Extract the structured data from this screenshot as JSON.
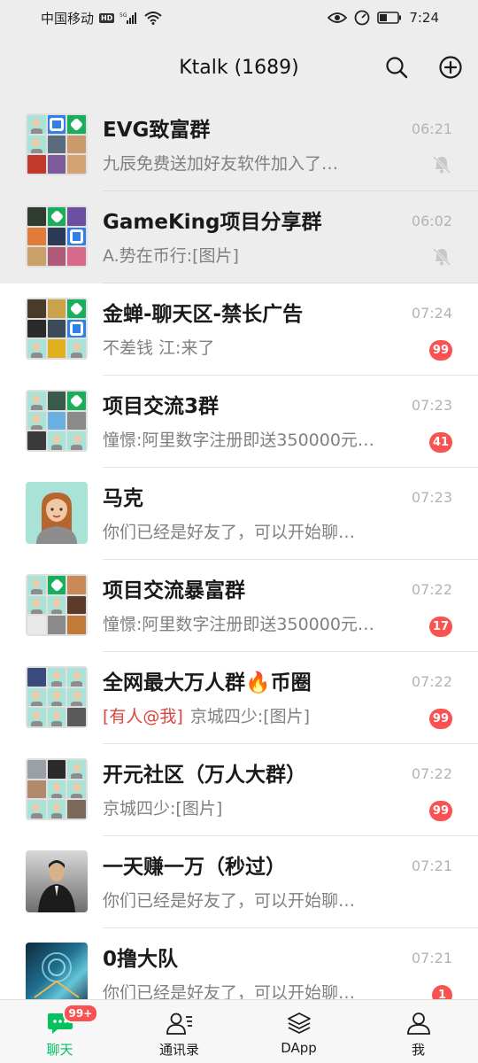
{
  "status_bar": {
    "carrier": "中国移动",
    "hd": "HD",
    "signal": "5G",
    "time": "7:24"
  },
  "header": {
    "title": "Ktalk (1689)"
  },
  "chats": [
    {
      "name": "EVG致富群",
      "time": "06:21",
      "preview": "九辰免费送加好友软件加入了…",
      "muted": true
    },
    {
      "name": "GameKing项目分享群",
      "time": "06:02",
      "preview": "A.势在币行:[图片]",
      "muted": true
    },
    {
      "name": "金蝉-聊天区-禁长广告",
      "time": "07:24",
      "preview": "不差钱 江:来了",
      "unread": "99"
    },
    {
      "name": "项目交流3群",
      "time": "07:23",
      "preview": "憧憬:阿里数字注册即送350000元…",
      "unread": "41"
    },
    {
      "name": "马克",
      "time": "07:23",
      "preview": "你们已经是好友了，可以开始聊…"
    },
    {
      "name": "项目交流暴富群",
      "time": "07:22",
      "preview": "憧憬:阿里数字注册即送350000元…",
      "unread": "17"
    },
    {
      "name": "全网最大万人群🔥币圈",
      "time": "07:22",
      "mention": "[有人@我]",
      "preview": "京城四少:[图片]",
      "unread": "99"
    },
    {
      "name": "开元社区（万人大群）",
      "time": "07:22",
      "preview": "京城四少:[图片]",
      "unread": "99"
    },
    {
      "name": "一天赚一万（秒过）",
      "time": "07:21",
      "preview": "你们已经是好友了，可以开始聊…"
    },
    {
      "name": "0撸大队",
      "time": "07:21",
      "preview": "你们已经是好友了，可以开始聊…",
      "unread": "1"
    }
  ],
  "tabs": [
    {
      "label": "聊天",
      "badge": "99+",
      "icon": "chat-icon",
      "active": true
    },
    {
      "label": "通讯录",
      "icon": "contacts-icon"
    },
    {
      "label": "DApp",
      "icon": "layers-icon"
    },
    {
      "label": "我",
      "icon": "person-icon"
    }
  ],
  "colors": {
    "accent": "#07c160",
    "badge": "#fa5151",
    "pinned_bg": "#ededed"
  }
}
